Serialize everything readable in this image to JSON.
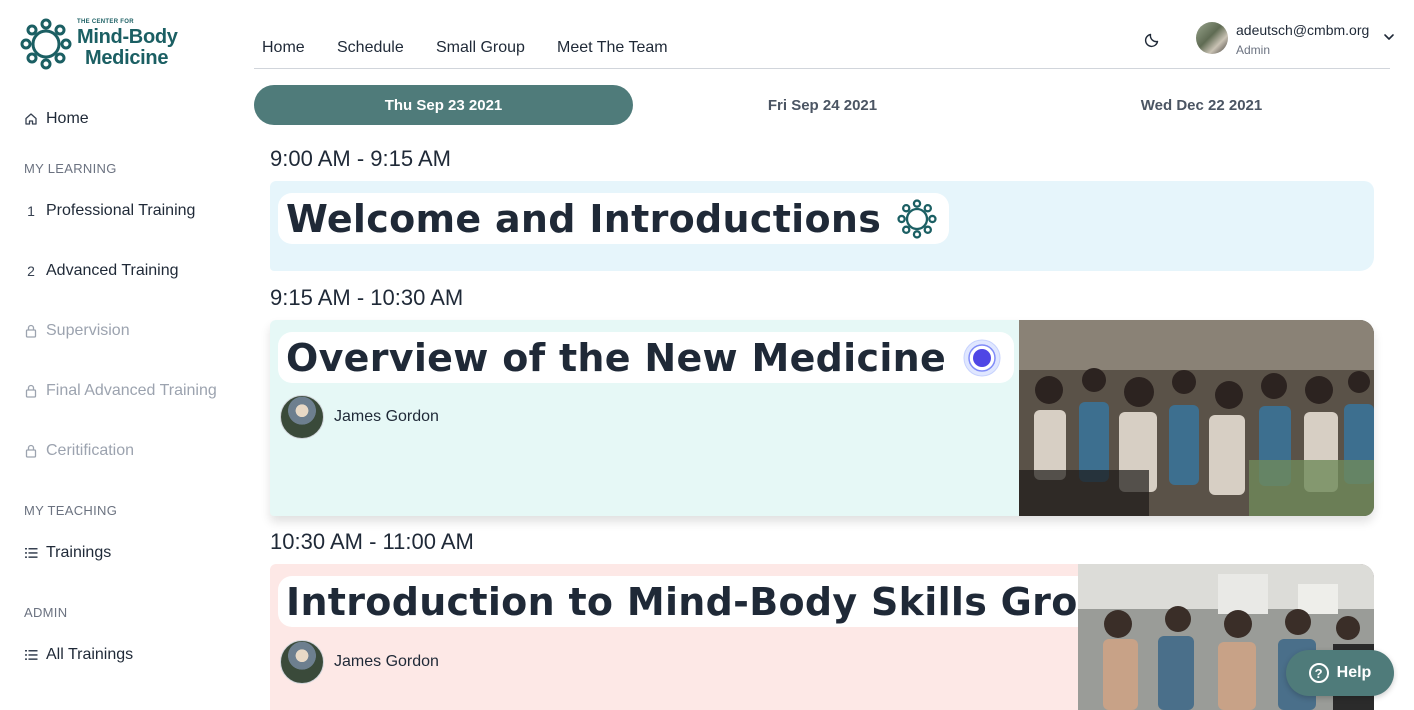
{
  "brand": {
    "small": "THE CENTER FOR",
    "line1": "Mind-Body",
    "line2": "Medicine"
  },
  "sidebar": {
    "home": "Home",
    "sections": {
      "learning": "MY LEARNING",
      "teaching": "MY TEACHING",
      "admin": "ADMIN"
    },
    "learning_items": [
      {
        "index": "1",
        "label": "Professional Training",
        "locked": false
      },
      {
        "index": "2",
        "label": "Advanced Training",
        "locked": false
      },
      {
        "label": "Supervision",
        "locked": true
      },
      {
        "label": "Final Advanced Training",
        "locked": true
      },
      {
        "label": "Ceritification",
        "locked": true
      }
    ],
    "teaching_items": [
      {
        "label": "Trainings"
      }
    ],
    "admin_items": [
      {
        "label": "All Trainings"
      }
    ]
  },
  "topnav": {
    "links": [
      "Home",
      "Schedule",
      "Small Group",
      "Meet The Team"
    ],
    "user": {
      "email": "adeutsch@cmbm.org",
      "role": "Admin"
    }
  },
  "date_tabs": [
    {
      "label": "Thu Sep 23 2021",
      "active": true
    },
    {
      "label": "Fri Sep 24 2021",
      "active": false
    },
    {
      "label": "Wed Dec 22 2021",
      "active": false
    }
  ],
  "sessions": [
    {
      "time": "9:00 AM - 9:15 AM",
      "title": "Welcome and Introductions",
      "icon": "cmbm-logo-icon",
      "speaker": "",
      "color": "#e6f5fb"
    },
    {
      "time": "9:15 AM - 10:30 AM",
      "title": "Overview of the New Medicine",
      "icon": "record-dot-icon",
      "speaker": "James Gordon",
      "color": "#e6f8f6"
    },
    {
      "time": "10:30 AM - 11:00 AM",
      "title": "Introduction to Mind-Body Skills Groups",
      "icon": "group-circle-icon",
      "speaker": "James Gordon",
      "color": "#fde8e6"
    }
  ],
  "help": {
    "label": "Help"
  }
}
